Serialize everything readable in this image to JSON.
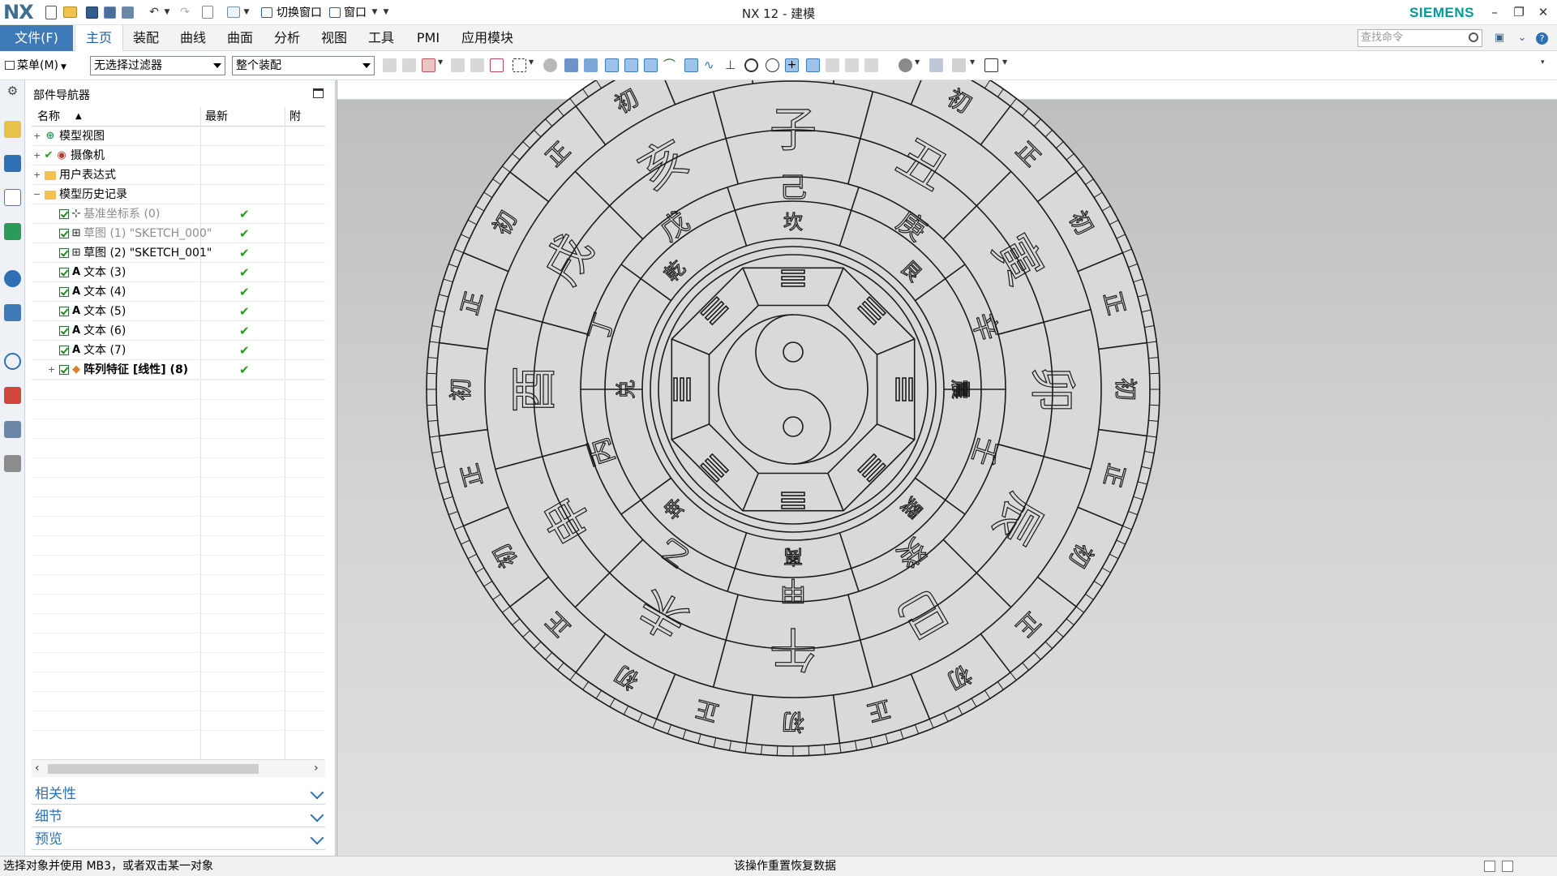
{
  "titlebar": {
    "logo": "NX",
    "title": "NX 12 - 建模",
    "brand": "SIEMENS",
    "switch_window": "切换窗口",
    "window_menu": "窗口",
    "minimize": "–",
    "restore": "❐",
    "close": "✕"
  },
  "ribbon": {
    "file_tab": "文件(F)",
    "tabs": [
      "主页",
      "装配",
      "曲线",
      "曲面",
      "分析",
      "视图",
      "工具",
      "PMI",
      "应用模块"
    ],
    "active_tab": "主页",
    "search_placeholder": "查找命令"
  },
  "toolbar": {
    "menu_label": "菜单(M)",
    "filter_value": "无选择过滤器",
    "scope_value": "整个装配"
  },
  "navigator": {
    "title": "部件导航器",
    "columns": [
      "名称",
      "最新",
      "附"
    ],
    "tree": [
      {
        "label": "模型视图",
        "level": 0,
        "expander": "+"
      },
      {
        "label": "摄像机",
        "level": 0,
        "expander": "+"
      },
      {
        "label": "用户表达式",
        "level": 0,
        "expander": "+"
      },
      {
        "label": "模型历史记录",
        "level": 0,
        "expander": "−"
      },
      {
        "label": "基准坐标系 (0)",
        "level": 1,
        "tick": "✔",
        "style": "gray"
      },
      {
        "label": "草图 (1) \"SKETCH_000\"",
        "level": 1,
        "tick": "✔",
        "style": "gray"
      },
      {
        "label": "草图 (2) \"SKETCH_001\"",
        "level": 1,
        "tick": "✔",
        "style": "normal"
      },
      {
        "label": "文本 (3)",
        "level": 1,
        "tick": "✔",
        "style": "normal"
      },
      {
        "label": "文本 (4)",
        "level": 1,
        "tick": "✔",
        "style": "normal"
      },
      {
        "label": "文本 (5)",
        "level": 1,
        "tick": "✔",
        "style": "normal"
      },
      {
        "label": "文本 (6)",
        "level": 1,
        "tick": "✔",
        "style": "normal"
      },
      {
        "label": "文本 (7)",
        "level": 1,
        "tick": "✔",
        "style": "normal"
      },
      {
        "label": "阵列特征 [线性] (8)",
        "level": 1,
        "tick": "✔",
        "style": "bold",
        "expander": "+"
      }
    ],
    "text_feature_glyph": "A",
    "sections": [
      "相关性",
      "细节",
      "预览"
    ]
  },
  "model": {
    "center_ring": [
      "坎",
      "艮",
      "震",
      "巽",
      "离",
      "坤",
      "兑",
      "乾"
    ],
    "stems_ring": [
      "己",
      "庚",
      "辛",
      "壬",
      "癸",
      "甲",
      "乙",
      "丙",
      "丁",
      "戊"
    ],
    "branches_ring": [
      "子",
      "丑",
      "寅",
      "卯",
      "辰",
      "巳",
      "午",
      "未",
      "申",
      "酉",
      "戌",
      "亥"
    ],
    "outer_ring": [
      "初",
      "正"
    ],
    "edge_color": "#1a1a1a",
    "face_color": "#d9d9d9"
  },
  "status": {
    "prompt": "选择对象并使用 MB3，或者双击某一对象",
    "message": "该操作重置恢复数据"
  },
  "colors": {
    "accent": "#3e7ab8",
    "siemens": "#009999",
    "check": "#1fa31f"
  }
}
